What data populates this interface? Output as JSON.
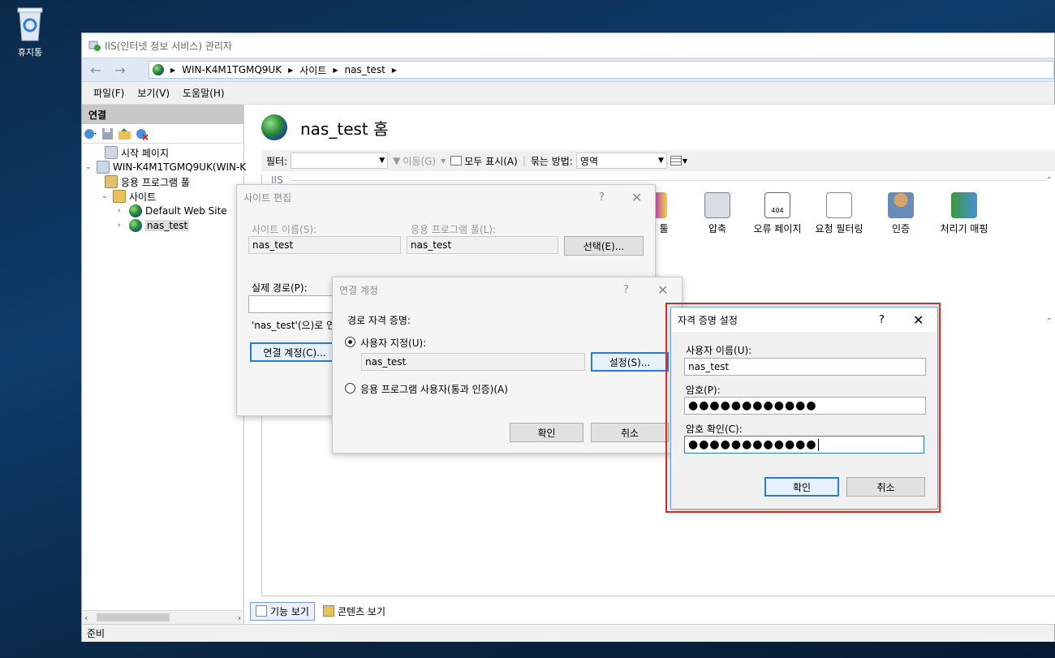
{
  "desktop": {
    "recycle_bin_label": "휴지통"
  },
  "window": {
    "title": "IIS(인터넷 정보 서비스) 관리자",
    "breadcrumb": [
      "WIN-K4M1TGMQ9UK",
      "사이트",
      "nas_test"
    ],
    "menu": [
      "파일(F)",
      "보기(V)",
      "도움말(H)"
    ],
    "status": "준비"
  },
  "connections": {
    "header": "연결",
    "tree": [
      {
        "label": "시작 페이지"
      },
      {
        "label": "WIN-K4M1TGMQ9UK(WIN-K"
      },
      {
        "label": "응용 프로그램 풀"
      },
      {
        "label": "사이트"
      },
      {
        "label": "Default Web Site"
      },
      {
        "label": "nas_test"
      }
    ]
  },
  "home": {
    "title": "nas_test 홈",
    "filter_label": "필터:",
    "go_label": "이동(G)",
    "show_all_label": "모두 표시(A)",
    "group_by_label": "묶는 방법:",
    "group_by_value": "영역",
    "section_label": "IIS",
    "features": [
      "툴",
      "압축",
      "오류 페이지",
      "요청 필터링",
      "인증",
      "처리기 매핑"
    ],
    "view_tabs": [
      "기능 보기",
      "콘텐츠 보기"
    ]
  },
  "edit_site_dialog": {
    "title": "사이트 편집",
    "site_name_label": "사이트 이름(S):",
    "site_name_value": "nas_test",
    "app_pool_label": "응용 프로그램 풀(L):",
    "app_pool_value": "nas_test",
    "select_button": "선택(E)...",
    "physical_path_label": "실제 경로(P):",
    "connect_note": "'nas_test'(으)로 연결",
    "connect_as_button": "연결 계정(C)..."
  },
  "connect_as_dialog": {
    "title": "연결 계정",
    "path_credentials_label": "경로 자격 증명:",
    "specific_user_label": "사용자 지정(U):",
    "specific_user_value": "nas_test",
    "set_button": "설정(S)...",
    "app_user_label": "응용 프로그램 사용자(통과 인증)(A)",
    "ok_button": "확인",
    "cancel_button": "취소"
  },
  "set_credentials_dialog": {
    "title": "자격 증명 설정",
    "username_label": "사용자 이름(U):",
    "username_value": "nas_test",
    "password_label": "암호(P):",
    "password_value": "●●●●●●●●●●●●",
    "confirm_label": "암호 확인(C):",
    "confirm_value": "●●●●●●●●●●●●",
    "ok_button": "확인",
    "cancel_button": "취소",
    "highlight_color": "#d42b2b"
  }
}
